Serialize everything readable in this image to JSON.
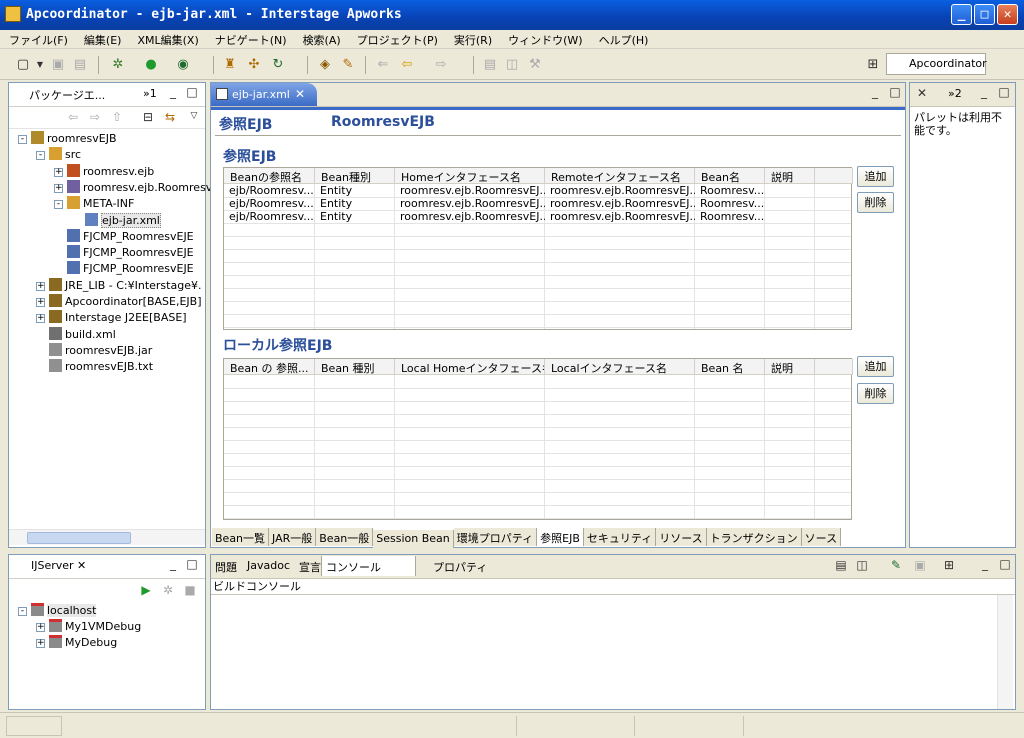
{
  "window": {
    "title": "Apcoordinator - ejb-jar.xml - Interstage Apworks"
  },
  "menu": [
    "ファイル(F)",
    "編集(E)",
    "XML編集(X)",
    "ナビゲート(N)",
    "検索(A)",
    "プロジェクト(P)",
    "実行(R)",
    "ウィンドウ(W)",
    "ヘルプ(H)"
  ],
  "perspective": {
    "label": "Apcoordinator"
  },
  "package_explorer": {
    "tab": "パッケージエ...",
    "tab2": "»1",
    "tree": [
      {
        "label": "roomresvEJB",
        "depth": 0,
        "exp": "-"
      },
      {
        "label": "src",
        "depth": 1,
        "exp": "-"
      },
      {
        "label": "roomresv.ejb",
        "depth": 2,
        "exp": "+"
      },
      {
        "label": "roomresv.ejb.Roomresv",
        "depth": 2,
        "exp": "+"
      },
      {
        "label": "META-INF",
        "depth": 2,
        "exp": "-"
      },
      {
        "label": "ejb-jar.xml",
        "depth": 3,
        "exp": "",
        "selected": true
      },
      {
        "label": "FJCMP_RoomresvEJE",
        "depth": 2,
        "exp": ""
      },
      {
        "label": "FJCMP_RoomresvEJE",
        "depth": 2,
        "exp": ""
      },
      {
        "label": "FJCMP_RoomresvEJE",
        "depth": 2,
        "exp": ""
      },
      {
        "label": "JRE_LIB - C:¥Interstage¥.",
        "depth": 1,
        "exp": "+"
      },
      {
        "label": "Apcoordinator[BASE,EJB]",
        "depth": 1,
        "exp": "+"
      },
      {
        "label": "Interstage J2EE[BASE]",
        "depth": 1,
        "exp": "+"
      },
      {
        "label": "build.xml",
        "depth": 1,
        "exp": ""
      },
      {
        "label": "roomresvEJB.jar",
        "depth": 1,
        "exp": ""
      },
      {
        "label": "roomresvEJB.txt",
        "depth": 1,
        "exp": ""
      }
    ]
  },
  "editor": {
    "tab": "ejb-jar.xml",
    "header_label": "参照EJB",
    "header_name": "RoomresvEJB",
    "ref_section": {
      "title": "参照EJB",
      "columns": [
        "Beanの参照名",
        "Bean種別",
        "Homeインタフェース名",
        "Remoteインタフェース名",
        "Bean名",
        "説明"
      ],
      "rows": [
        [
          "ejb/Roomresv...",
          "Entity",
          "roomresv.ejb.RoomresvEJ...",
          "roomresv.ejb.RoomresvEJ...",
          "Roomresv...",
          ""
        ],
        [
          "ejb/Roomresv...",
          "Entity",
          "roomresv.ejb.RoomresvEJ...",
          "roomresv.ejb.RoomresvEJ...",
          "Roomresv...",
          ""
        ],
        [
          "ejb/Roomresv...",
          "Entity",
          "roomresv.ejb.RoomresvEJ...",
          "roomresv.ejb.RoomresvEJ...",
          "Roomresv...",
          ""
        ]
      ],
      "add": "追加",
      "delete": "削除"
    },
    "local_section": {
      "title": "ローカル参照EJB",
      "columns": [
        "Bean の 参照...",
        "Bean 種別",
        "Local Homeインタフェース名",
        "Localインタフェース名",
        "Bean 名",
        "説明"
      ],
      "add": "追加",
      "delete": "削除"
    },
    "bottom_tabs": [
      "Bean一覧",
      "JAR一般",
      "Bean一般",
      "Session Bean",
      "環境プロパティ",
      "参照EJB",
      "セキュリティ",
      "リソース",
      "トランザクション",
      "ソース"
    ],
    "active_tab": "参照EJB"
  },
  "palette": {
    "tab2": "»2",
    "text": "パレットは利用不能です。"
  },
  "ijserver": {
    "tab": "IJServer",
    "tree": [
      {
        "label": "localhost",
        "depth": 0,
        "exp": "-"
      },
      {
        "label": "My1VMDebug",
        "depth": 1,
        "exp": "+"
      },
      {
        "label": "MyDebug",
        "depth": 1,
        "exp": "+"
      }
    ]
  },
  "console": {
    "tabs": [
      "問題",
      "Javadoc",
      "宣言",
      "コンソール",
      "プロパティ"
    ],
    "subtitle": "ビルドコンソール"
  }
}
